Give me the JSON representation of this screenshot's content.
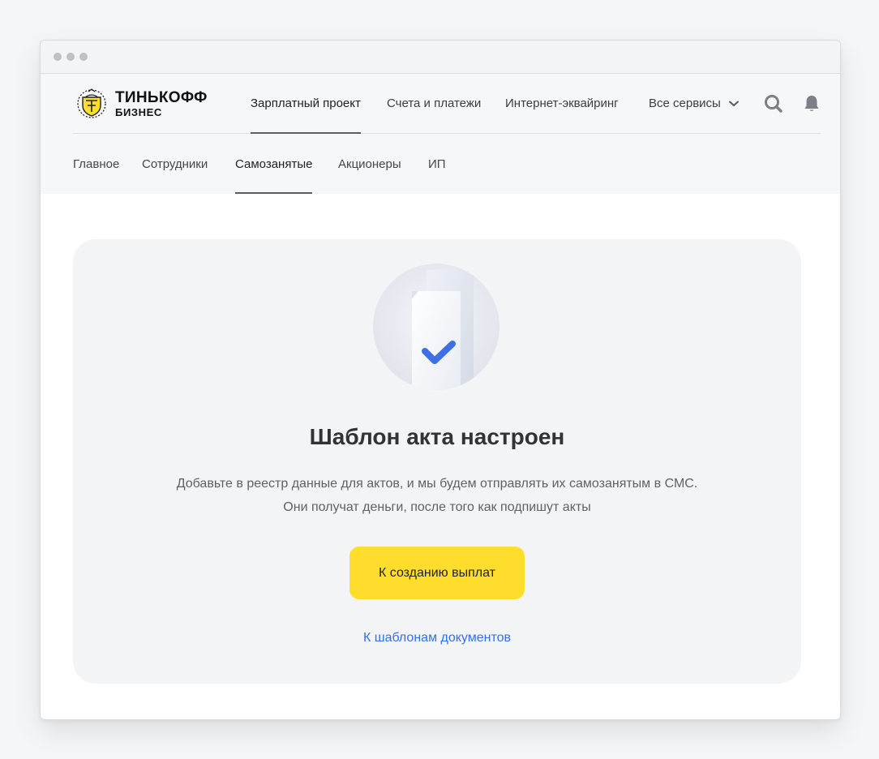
{
  "brand": {
    "name": "ТИНЬКОФФ",
    "sub": "БИЗНЕС"
  },
  "main_nav": {
    "items": [
      {
        "label": "Зарплатный проект",
        "active": true
      },
      {
        "label": "Счета и платежи",
        "active": false
      },
      {
        "label": "Интернет-эквайринг",
        "active": false
      },
      {
        "label": "Все сервисы",
        "active": false,
        "dropdown": true
      }
    ],
    "icons": [
      "search-icon",
      "bell-icon"
    ]
  },
  "sub_nav": {
    "items": [
      {
        "label": "Главное",
        "active": false
      },
      {
        "label": "Сотрудники",
        "active": false
      },
      {
        "label": "Самозанятые",
        "active": true
      },
      {
        "label": "Акционеры",
        "active": false
      },
      {
        "label": "ИП",
        "active": false
      }
    ]
  },
  "card": {
    "illustration": "document-check-icon",
    "title": "Шаблон акта настроен",
    "description_lines": [
      "Добавьте в реестр данные для актов, и мы будем отправлять их самозанятым в СМС.",
      "Они получат деньги, после того как подпишут акты"
    ],
    "primary_button": "К созданию выплат",
    "link": "К шаблонам документов"
  },
  "colors": {
    "accent_yellow": "#ffdd2d",
    "link_blue": "#336fee",
    "check_blue": "#3d6fe6",
    "card_bg": "#f3f4f6"
  }
}
